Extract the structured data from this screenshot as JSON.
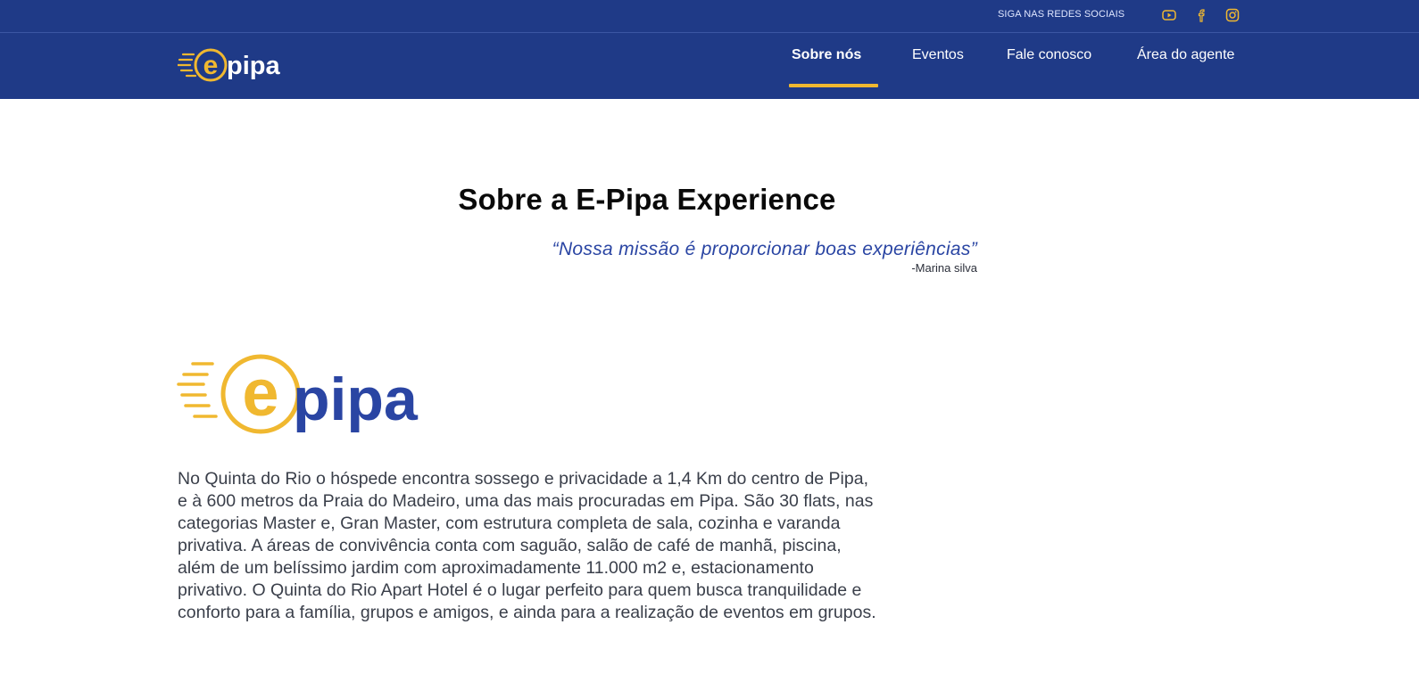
{
  "brand": {
    "logo_text_e": "e",
    "logo_text_rest": "pipa",
    "accent_color": "#f0b830",
    "primary_color": "#1f3a87",
    "logo_blue": "#2a45a3"
  },
  "topbar": {
    "social_label": "SIGA NAS REDES SOCIAIS",
    "icons": [
      "youtube-icon",
      "facebook-icon",
      "instagram-icon"
    ]
  },
  "nav": {
    "items": [
      {
        "label": "Sobre nós",
        "active": true
      },
      {
        "label": "Eventos",
        "active": false
      },
      {
        "label": "Fale conosco",
        "active": false
      },
      {
        "label": "Área do agente",
        "active": false
      }
    ]
  },
  "main": {
    "title": "Sobre a E-Pipa Experience",
    "quote": "“Nossa missão é proporcionar boas experiências”",
    "quote_author": "-Marina silva",
    "description": "No Quinta do Rio o hóspede encontra sossego e privacidade a 1,4 Km do centro de Pipa, e à 600 metros da Praia do Madeiro, uma das mais procuradas em Pipa. São 30 flats, nas categorias Master e, Gran Master, com estrutura completa de sala, cozinha e varanda privativa. A áreas de convivência conta com saguão, salão de café de manhã, piscina, além de um belíssimo jardim com aproximadamente 11.000 m2 e, estacionamento privativo. O Quinta do Rio Apart Hotel é o lugar perfeito para quem busca tranquilidade e conforto para a família, grupos e amigos, e ainda para a realização de eventos em grupos."
  }
}
